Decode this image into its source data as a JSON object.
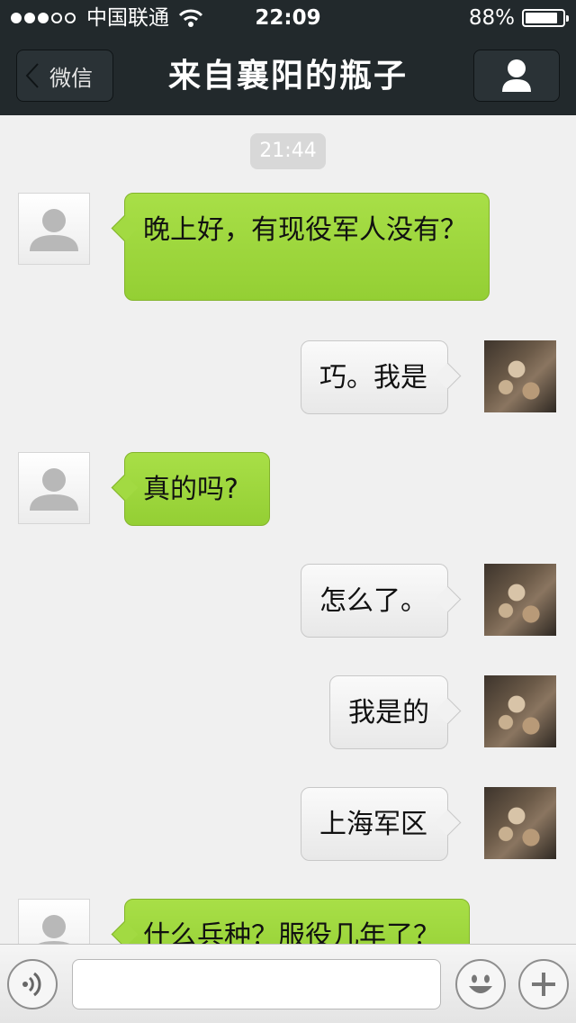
{
  "status_bar": {
    "carrier": "中国联通",
    "time": "22:09",
    "battery_percent": "88%",
    "battery_level": 0.88,
    "signal_bars_filled": 3,
    "signal_bars_total": 5
  },
  "nav": {
    "back_label": "微信",
    "title": "来自襄阳的瓶子",
    "profile_icon": "person-icon"
  },
  "chat": {
    "timestamp": "21:44",
    "messages": [
      {
        "side": "in",
        "text": "晚上好，有现役军人没有？"
      },
      {
        "side": "out",
        "text": "巧。我是"
      },
      {
        "side": "in",
        "text": "真的吗?"
      },
      {
        "side": "out",
        "text": "怎么了。"
      },
      {
        "side": "out",
        "text": "我是的"
      },
      {
        "side": "out",
        "text": "上海军区"
      },
      {
        "side": "in",
        "text": "什么兵种？服役几年了？"
      }
    ]
  },
  "input_bar": {
    "voice_icon": "voice-icon",
    "emoji_icon": "emoji-icon",
    "add_icon": "add-icon",
    "text_value": ""
  },
  "colors": {
    "nav_bg": "#22292c",
    "chat_bg": "#f0f0f0",
    "incoming_bubble": "#9dd63c",
    "outgoing_bubble": "#f0f0f0"
  }
}
